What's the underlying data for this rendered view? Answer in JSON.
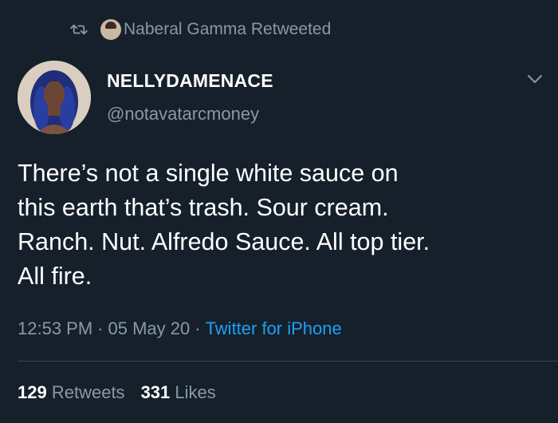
{
  "retweet_banner": {
    "text": "Naberal Gamma Retweeted"
  },
  "author": {
    "display_name": "NELLYDAMENACE",
    "handle": "@notavatarcmoney"
  },
  "tweet": {
    "text": "There’s not a single white sauce on\nthis earth that’s trash. Sour cream.\nRanch. Nut. Alfredo Sauce. All top tier.\nAll fire."
  },
  "meta": {
    "time": "12:53 PM",
    "separator": "·",
    "date": "05 May 20",
    "source": "Twitter for iPhone"
  },
  "stats": {
    "retweets_count": "129",
    "retweets_label": "Retweets",
    "likes_count": "331",
    "likes_label": "Likes"
  },
  "colors": {
    "background": "#15202b",
    "secondary_text": "#8899a6",
    "link": "#1da1f2",
    "divider": "#38444d"
  },
  "icons": {
    "retweet": "retweet-icon",
    "chevron": "chevron-down-icon"
  }
}
